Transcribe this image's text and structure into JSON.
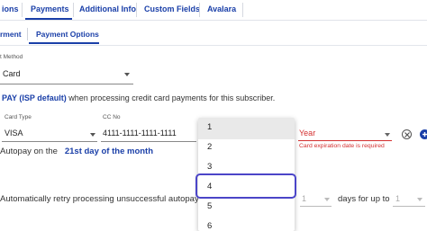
{
  "top_tabs": [
    {
      "label": "ions"
    },
    {
      "label": "Payments"
    },
    {
      "label": "Additional Info"
    },
    {
      "label": "Custom Fields"
    },
    {
      "label": "Avalara"
    }
  ],
  "sub_tabs": [
    {
      "label": "rment"
    },
    {
      "label": "Payment Options"
    }
  ],
  "payment_method": {
    "label": "t Method",
    "value": "Card"
  },
  "autopay_info": {
    "highlight": "PAY (ISP default)",
    "rest": " when processing credit card payments for this subscriber."
  },
  "card_type": {
    "label": "Card Type",
    "value": "VISA"
  },
  "cc_no": {
    "label": "CC No",
    "value": "4111-1111-1111-1111"
  },
  "year": {
    "placeholder": "Year",
    "error": "Card expiration date is required"
  },
  "autopay_day": {
    "prefix": "Autopay on the",
    "value": "21st day of the month"
  },
  "retry": {
    "text": "Automatically retry processing unsuccessful autopay credi",
    "count_value": "1",
    "days_text": "days for up to",
    "upto_value": "1"
  },
  "dropdown": {
    "options": [
      "1",
      "2",
      "3",
      "4",
      "5",
      "6"
    ],
    "selected": "4"
  },
  "colors": {
    "primary": "#1a3fa8",
    "error": "#d32f2f",
    "highlight_border": "#4b45c8"
  },
  "icons": [
    "close-icon",
    "add-icon"
  ]
}
